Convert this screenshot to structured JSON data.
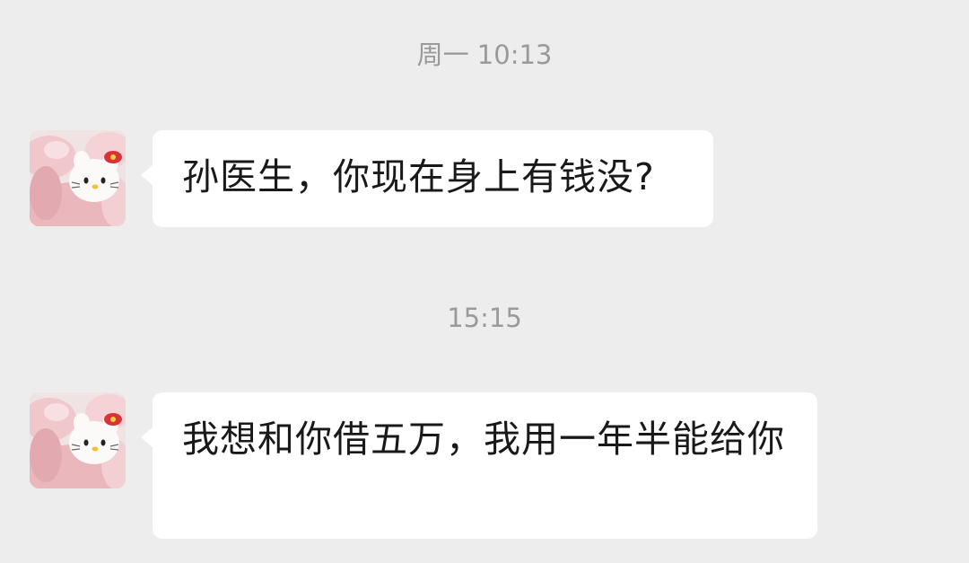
{
  "chat": {
    "messages": [
      {
        "timestamp": "周一 10:13",
        "sender_avatar_icon": "hello-kitty-avatar-icon",
        "text": "孙医生，你现在身上有钱没?"
      },
      {
        "timestamp": "15:15",
        "sender_avatar_icon": "hello-kitty-avatar-icon",
        "text": "我想和你借五万，我用一年半能给你"
      }
    ]
  },
  "colors": {
    "background": "#ededed",
    "bubble": "#ffffff",
    "timestamp_text": "#9a9a9a",
    "message_text": "#191919"
  }
}
